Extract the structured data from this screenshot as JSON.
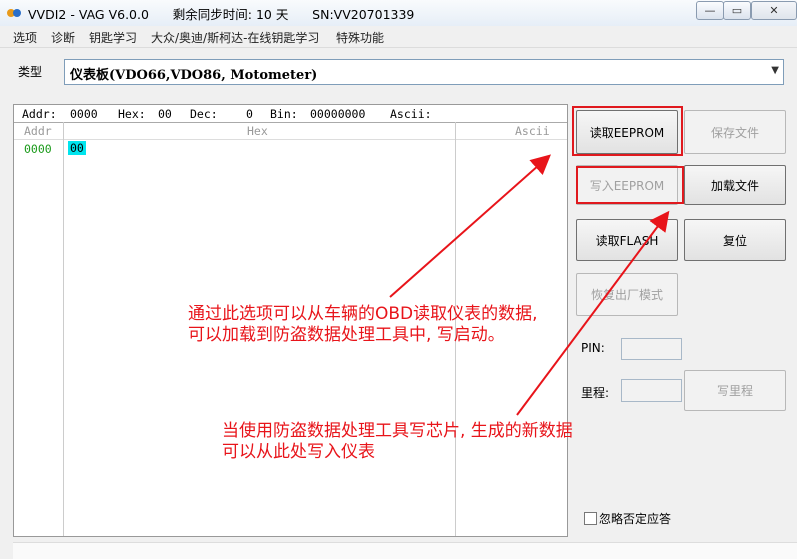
{
  "window": {
    "title": "VVDI2 - VAG V6.0.0      剩余同步时间: 10 天      SN:VV20701339",
    "controls": {
      "minimize": "—",
      "maximize": "▭",
      "close": "✕"
    }
  },
  "menu": [
    "选项",
    "诊断",
    "钥匙学习",
    "大众/奥迪/斯柯达-在线钥匙学习",
    "特殊功能"
  ],
  "type_row": {
    "label": "类型",
    "selected": "仪表板(VDO66,VDO86, Motometer)"
  },
  "hex": {
    "info": {
      "addr_label": "Addr:",
      "addr_value": "0000",
      "hex_label": "Hex:",
      "hex_value": "00",
      "dec_label": "Dec:",
      "dec_value": "0",
      "bin_label": "Bin:",
      "bin_value": "00000000",
      "ascii_label": "Ascii:"
    },
    "columns": {
      "addr": "Addr",
      "hex": "Hex",
      "ascii": "Ascii"
    },
    "rows": [
      {
        "addr": "0000",
        "hex": "00"
      }
    ]
  },
  "buttons": {
    "read_eeprom": "读取EEPROM",
    "save_file": "保存文件",
    "write_eeprom": "写入EEPROM",
    "load_file": "加载文件",
    "read_flash": "读取FLASH",
    "reset": "复位",
    "restore_factory": "恢复出厂模式",
    "write_mileage": "写里程"
  },
  "fields": {
    "pin_label": "PIN:",
    "mileage_label": "里程:"
  },
  "checkbox": {
    "label": "忽略否定应答",
    "checked": false
  },
  "annotations": {
    "note1": "通过此选项可以从车辆的OBD读取仪表的数据,\n可以加载到防盗数据处理工具中, 写启动。",
    "note2": "当使用防盗数据处理工具写芯片, 生成的新数据\n可以从此处写入仪表"
  },
  "colors": {
    "annotation": "#e8141a",
    "hex_highlight": "#00e5ee",
    "addr_text": "#1a9a1a"
  }
}
